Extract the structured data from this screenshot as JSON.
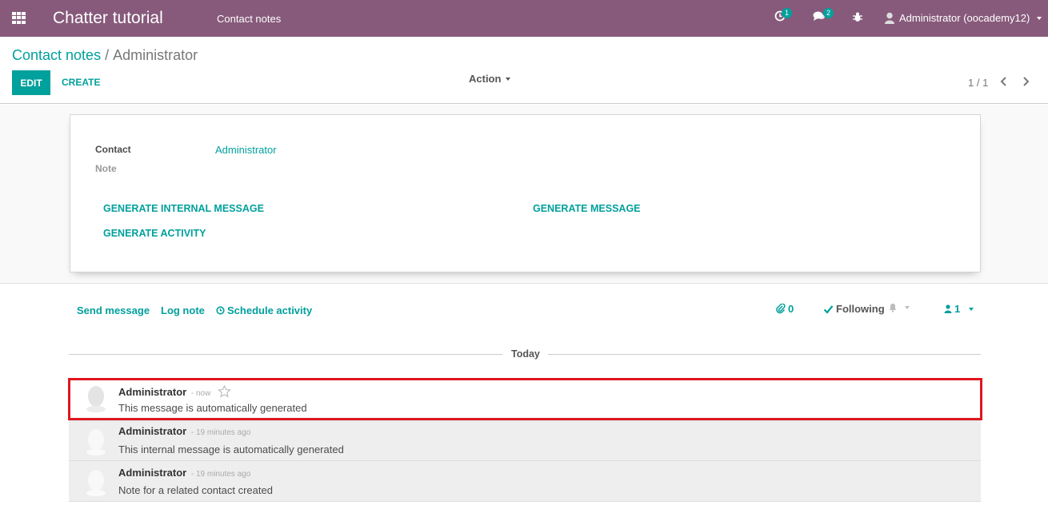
{
  "navbar": {
    "brand": "Chatter tutorial",
    "menu": "Contact notes",
    "activity_count": "1",
    "messages_count": "2",
    "user": "Administrator (oocademy12)"
  },
  "control_panel": {
    "breadcrumb_parent": "Contact notes",
    "breadcrumb_sep": "/",
    "breadcrumb_current": "Administrator",
    "edit_label": "EDIT",
    "create_label": "CREATE",
    "action_label": "Action",
    "pager": "1 / 1"
  },
  "form": {
    "contact_label": "Contact",
    "contact_value": "Administrator",
    "note_label": "Note",
    "btn_generate_internal": "GENERATE INTERNAL MESSAGE",
    "btn_generate_message": "GENERATE MESSAGE",
    "btn_generate_activity": "GENERATE ACTIVITY"
  },
  "chatter": {
    "send_message": "Send message",
    "log_note": "Log note",
    "schedule_activity": "Schedule activity",
    "attachments_count": "0",
    "following": "Following",
    "followers_count": "1",
    "date_separator": "Today",
    "messages": [
      {
        "author": "Administrator",
        "date": "- now",
        "body": "This message is automatically generated"
      },
      {
        "author": "Administrator",
        "date": "- 19 minutes ago",
        "body": "This internal message is automatically generated"
      },
      {
        "author": "Administrator",
        "date": "- 19 minutes ago",
        "body": "Note for a related contact created"
      }
    ]
  },
  "colors": {
    "navbar": "#875a7b",
    "accent": "#00a09d",
    "highlight": "#e0161f"
  }
}
